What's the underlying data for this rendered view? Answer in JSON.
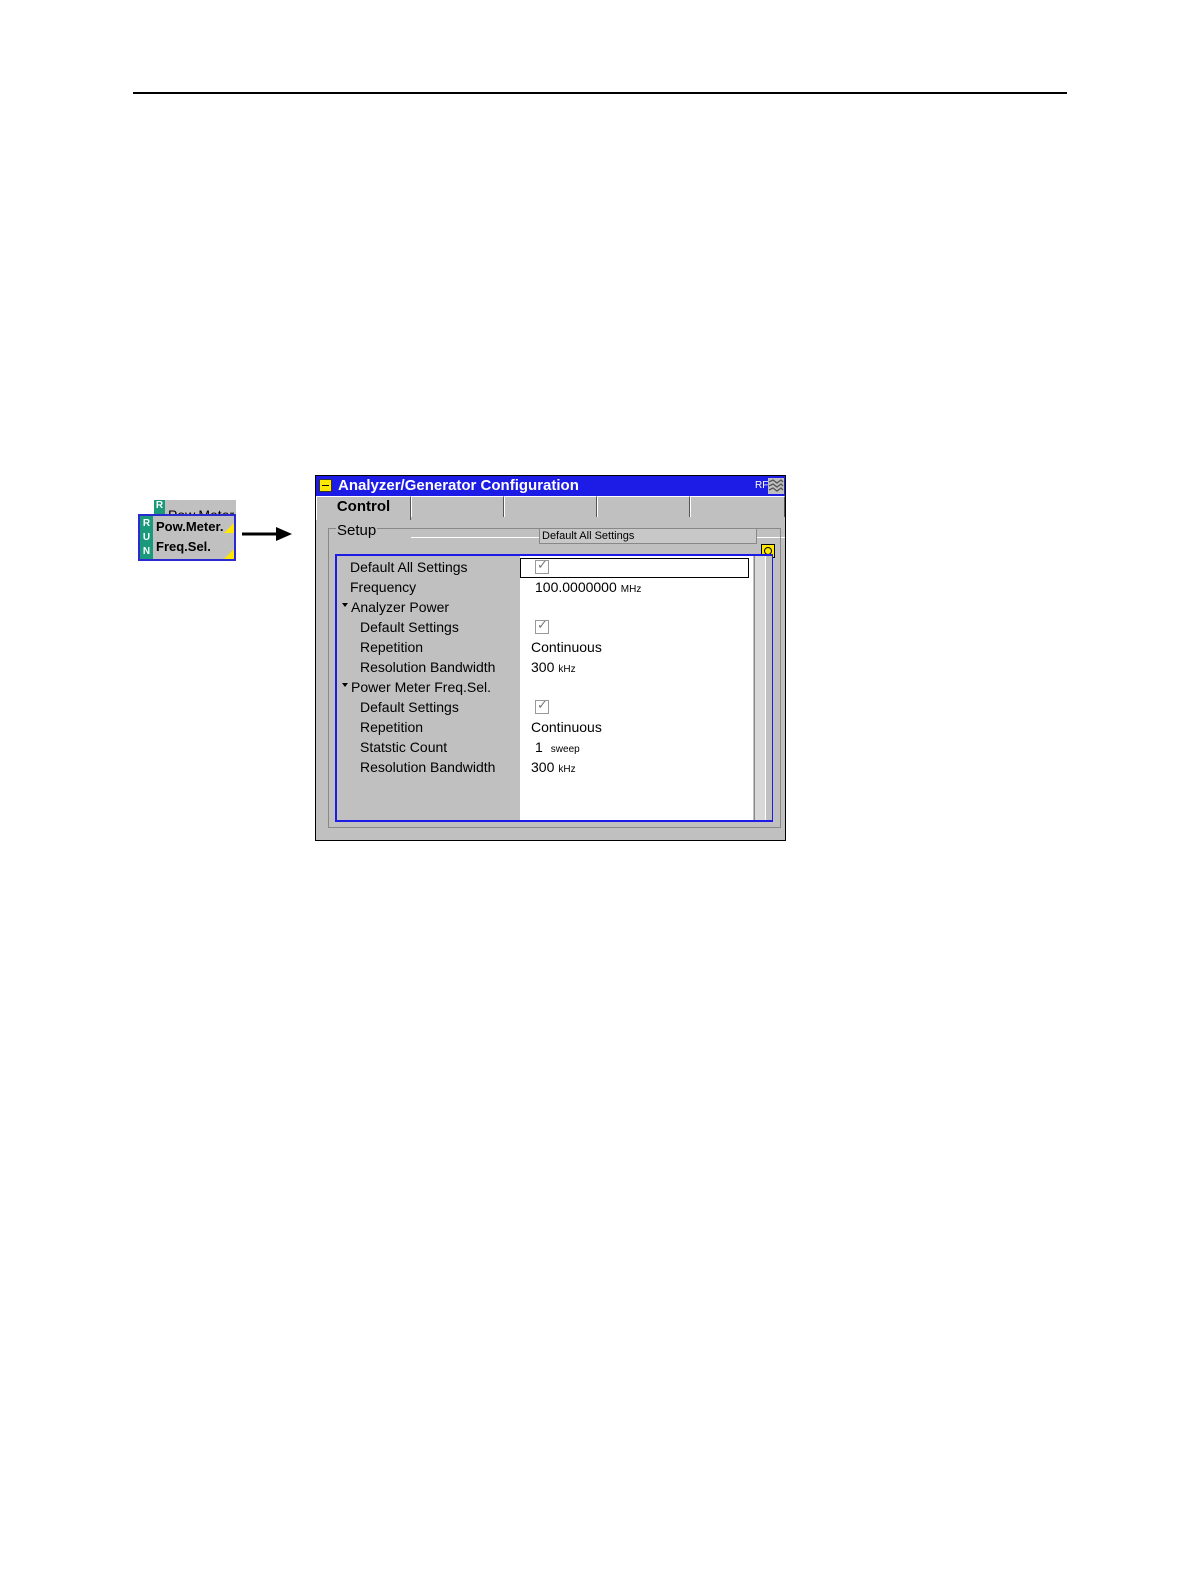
{
  "softkeys": {
    "back_run": "R",
    "back_label": "Pow.Meter",
    "front_run": [
      "R",
      "U",
      "N"
    ],
    "front_line1": "Pow.Meter.",
    "front_line2": "Freq.Sel."
  },
  "window": {
    "title": "Analyzer/Generator Configuration",
    "rf_label": "RF",
    "tabs": [
      "Control",
      "",
      "",
      "",
      ""
    ],
    "group_label": "Setup",
    "default_button": "Default All Settings"
  },
  "tree": {
    "rows": [
      {
        "label": "Default All Settings",
        "type": "checkbox",
        "checked": true
      },
      {
        "label": "Frequency",
        "value": "100.0000000",
        "unit": "MHz"
      },
      {
        "label": "Analyzer Power",
        "type": "group"
      },
      {
        "label": "Default Settings",
        "type": "checkbox",
        "checked": true
      },
      {
        "label": "Repetition",
        "value": "Continuous"
      },
      {
        "label": "Resolution Bandwidth",
        "value": "300",
        "unit": "kHz"
      },
      {
        "label": "Power Meter Freq.Sel.",
        "type": "group"
      },
      {
        "label": "Default Settings",
        "type": "checkbox",
        "checked": true
      },
      {
        "label": "Repetition",
        "value": "Continuous"
      },
      {
        "label": "Statstic Count",
        "value": "1",
        "unit": "sweep"
      },
      {
        "label": "Resolution Bandwidth",
        "value": "300",
        "unit": "kHz"
      }
    ]
  }
}
